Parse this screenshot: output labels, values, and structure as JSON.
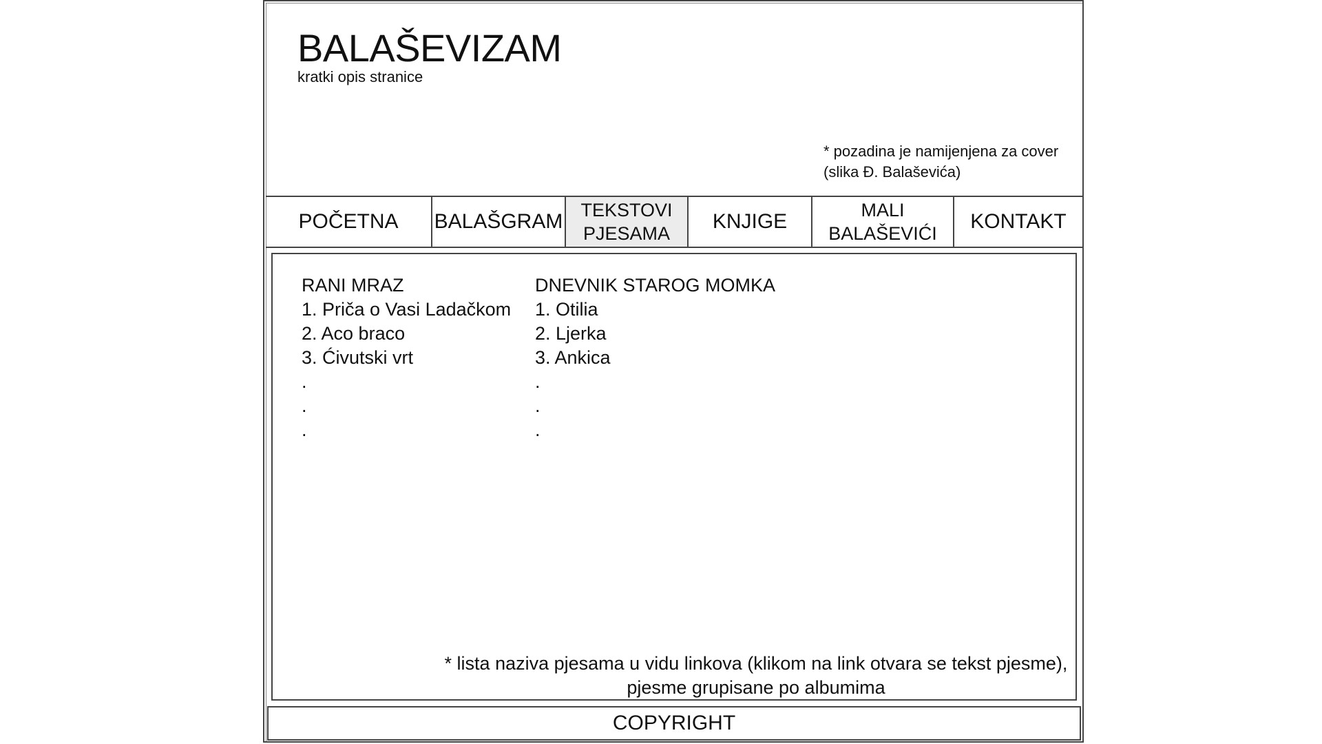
{
  "header": {
    "title": "BALAŠEVIZAM",
    "description": "kratki opis stranice",
    "cover_note_line1": "* pozadina je namijenjena za cover",
    "cover_note_line2": "(slika Đ. Balaševića)"
  },
  "nav": {
    "items": [
      {
        "line1": "POČETNA",
        "line2": ""
      },
      {
        "line1": "BALAŠGRAM",
        "line2": ""
      },
      {
        "line1": "TEKSTOVI",
        "line2": "PJESAMA"
      },
      {
        "line1": "KNJIGE",
        "line2": ""
      },
      {
        "line1": "MALI",
        "line2": "BALAŠEVIĆI"
      },
      {
        "line1": "KONTAKT",
        "line2": ""
      }
    ],
    "active_index": 2
  },
  "content": {
    "albums": [
      {
        "title": "RANI MRAZ",
        "songs": [
          "1. Priča o Vasi Ladačkom",
          "2. Aco braco",
          "3. Ćivutski vrt"
        ],
        "dots": [
          ".",
          ".",
          "."
        ]
      },
      {
        "title": "DNEVNIK STAROG MOMKA",
        "songs": [
          "1. Otilia",
          "2. Ljerka",
          "3. Ankica"
        ],
        "dots": [
          ".",
          ".",
          "."
        ]
      }
    ],
    "note_line1": "* lista naziva pjesama u vidu linkova (klikom na link otvara se tekst pjesme),",
    "note_line2": "pjesme grupisane po albumima"
  },
  "footer": {
    "text": "COPYRIGHT"
  }
}
